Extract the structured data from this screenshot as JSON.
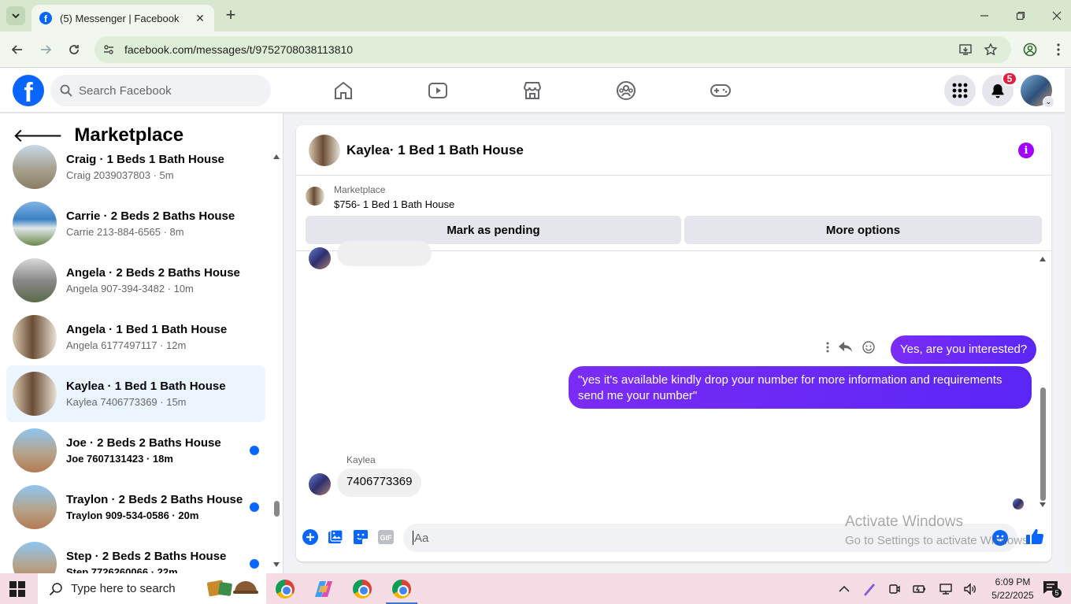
{
  "browser": {
    "tab_title": "(5) Messenger | Facebook",
    "url": "facebook.com/messages/t/9752708038113810"
  },
  "facebook": {
    "logo_letter": "f",
    "search_placeholder": "Search Facebook",
    "notification_count": "5",
    "nav_icons": [
      "home-icon",
      "watch-icon",
      "marketplace-icon",
      "groups-icon",
      "gaming-icon"
    ]
  },
  "sidebar": {
    "title": "Marketplace",
    "conversations": [
      {
        "name": "Craig · 1 Beds 1 Bath House",
        "sub": "Craig 2039037803 · 5m",
        "unread": false
      },
      {
        "name": "Carrie · 2 Beds 2 Baths House",
        "sub": "Carrie 213-884-6565 · 8m",
        "unread": false
      },
      {
        "name": "Angela · 2 Beds 2 Baths House",
        "sub": "Angela 907-394-3482 · 10m",
        "unread": false
      },
      {
        "name": "Angela · 1 Bed 1 Bath House",
        "sub": "Angela 6177497117 · 12m",
        "unread": false
      },
      {
        "name": "Kaylea · 1 Bed 1 Bath House",
        "sub": "Kaylea 7406773369 · 15m",
        "unread": false
      },
      {
        "name": "Joe · 2 Beds 2 Baths House",
        "sub": "Joe 7607131423 · 18m",
        "unread": true
      },
      {
        "name": "Traylon · 2 Beds 2 Baths House",
        "sub": "Traylon 909-534-0586 · 20m",
        "unread": true
      },
      {
        "name": "Step · 2 Beds 2 Baths House",
        "sub": "Step 7726260066 · 22m",
        "unread": true
      }
    ]
  },
  "chat": {
    "title": "Kaylea· 1 Bed 1 Bath House",
    "marketplace_label": "Marketplace",
    "listing_title": "$756- 1 Bed 1 Bath House",
    "mark_pending_label": "Mark as pending",
    "more_options_label": "More options",
    "messages": {
      "out_1": "Yes, are you interested?",
      "out_2": "\"yes it's available kindly drop your number for more information and requirements send me your number\"",
      "in_sender": "Kaylea",
      "in_1": "7406773369"
    },
    "composer_placeholder": "Aa"
  },
  "watermark": {
    "line1": "Activate Windows",
    "line2": "Go to Settings to activate Windows."
  },
  "taskbar": {
    "search_placeholder": "Type here to search",
    "time": "6:09 PM",
    "date": "5/22/2025",
    "notification_count": "5"
  },
  "colors": {
    "facebook_blue": "#0866ff",
    "message_purple": "#6623f6",
    "notification_red": "#e41e3f",
    "active_row": "#ebf5ff"
  }
}
